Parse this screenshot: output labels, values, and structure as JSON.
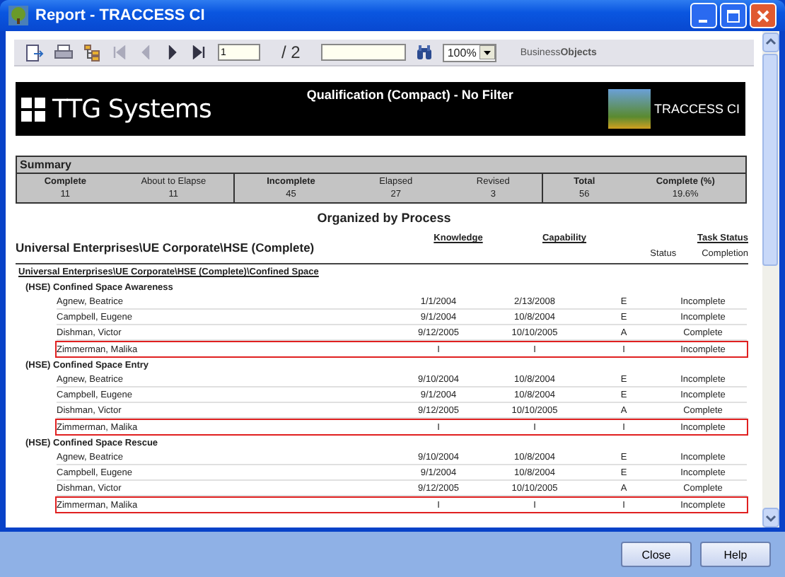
{
  "window": {
    "title": "Report - TRACCESS CI"
  },
  "toolbar": {
    "nav_buttons": [
      {
        "kind": "first",
        "disabled": true
      },
      {
        "kind": "prev",
        "disabled": true
      },
      {
        "kind": "next",
        "disabled": false
      },
      {
        "kind": "last",
        "disabled": false
      }
    ],
    "page": "1",
    "page_total": "/ 2",
    "zoom": "100%",
    "brand": "Business**Objects**"
  },
  "banner": {
    "logo": "TTG Systems",
    "title": "Qualification (Compact) - No Filter",
    "product": "TRACCESS CI"
  },
  "summary": {
    "title": "Summary",
    "groups": [
      [
        {
          "label": "Complete",
          "value": "11",
          "bold": true
        },
        {
          "label": "About to Elapse",
          "value": "11",
          "bold": false
        }
      ],
      [
        {
          "label": "Incomplete",
          "value": "45",
          "bold": true
        },
        {
          "label": "Elapsed",
          "value": "27",
          "bold": false
        },
        {
          "label": "Revised",
          "value": "3",
          "bold": false
        }
      ],
      [
        {
          "label": "Total",
          "value": "56",
          "bold": true
        },
        {
          "label": "Complete (%)",
          "value": "19.6%",
          "bold": true
        }
      ]
    ]
  },
  "report": {
    "heading": "Organized by Process",
    "org": "Universal Enterprises\\UE Corporate\\HSE (Complete)",
    "columns": {
      "knowledge": "Knowledge",
      "capability": "Capability",
      "task_status": "Task Status",
      "status": "Status",
      "completion": "Completion"
    },
    "group_path": "Universal Enterprises\\UE Corporate\\HSE (Complete)\\Confined Space",
    "sections": [
      {
        "title": "(HSE) Confined Space Awareness",
        "rows": [
          {
            "name": "Agnew, Beatrice",
            "knowledge": "1/1/2004",
            "capability": "2/13/2008",
            "status": "E",
            "completion": "Incomplete",
            "flagged": false
          },
          {
            "name": "Campbell, Eugene",
            "knowledge": "9/1/2004",
            "capability": "10/8/2004",
            "status": "E",
            "completion": "Incomplete",
            "flagged": false
          },
          {
            "name": "Dishman, Victor",
            "knowledge": "9/12/2005",
            "capability": "10/10/2005",
            "status": "A",
            "completion": "Complete",
            "flagged": false
          },
          {
            "name": "Zimmerman, Malika",
            "knowledge": "I",
            "capability": "I",
            "status": "I",
            "completion": "Incomplete",
            "flagged": true
          }
        ]
      },
      {
        "title": "(HSE) Confined Space Entry",
        "rows": [
          {
            "name": "Agnew, Beatrice",
            "knowledge": "9/10/2004",
            "capability": "10/8/2004",
            "status": "E",
            "completion": "Incomplete",
            "flagged": false
          },
          {
            "name": "Campbell, Eugene",
            "knowledge": "9/1/2004",
            "capability": "10/8/2004",
            "status": "E",
            "completion": "Incomplete",
            "flagged": false
          },
          {
            "name": "Dishman, Victor",
            "knowledge": "9/12/2005",
            "capability": "10/10/2005",
            "status": "A",
            "completion": "Complete",
            "flagged": false
          },
          {
            "name": "Zimmerman, Malika",
            "knowledge": "I",
            "capability": "I",
            "status": "I",
            "completion": "Incomplete",
            "flagged": true
          }
        ]
      },
      {
        "title": "(HSE) Confined Space Rescue",
        "rows": [
          {
            "name": "Agnew, Beatrice",
            "knowledge": "9/10/2004",
            "capability": "10/8/2004",
            "status": "E",
            "completion": "Incomplete",
            "flagged": false
          },
          {
            "name": "Campbell, Eugene",
            "knowledge": "9/1/2004",
            "capability": "10/8/2004",
            "status": "E",
            "completion": "Incomplete",
            "flagged": false
          },
          {
            "name": "Dishman, Victor",
            "knowledge": "9/12/2005",
            "capability": "10/10/2005",
            "status": "A",
            "completion": "Complete",
            "flagged": false
          },
          {
            "name": "Zimmerman, Malika",
            "knowledge": "I",
            "capability": "I",
            "status": "I",
            "completion": "Incomplete",
            "flagged": true
          }
        ]
      }
    ]
  },
  "buttons": [
    "Close",
    "Help"
  ]
}
